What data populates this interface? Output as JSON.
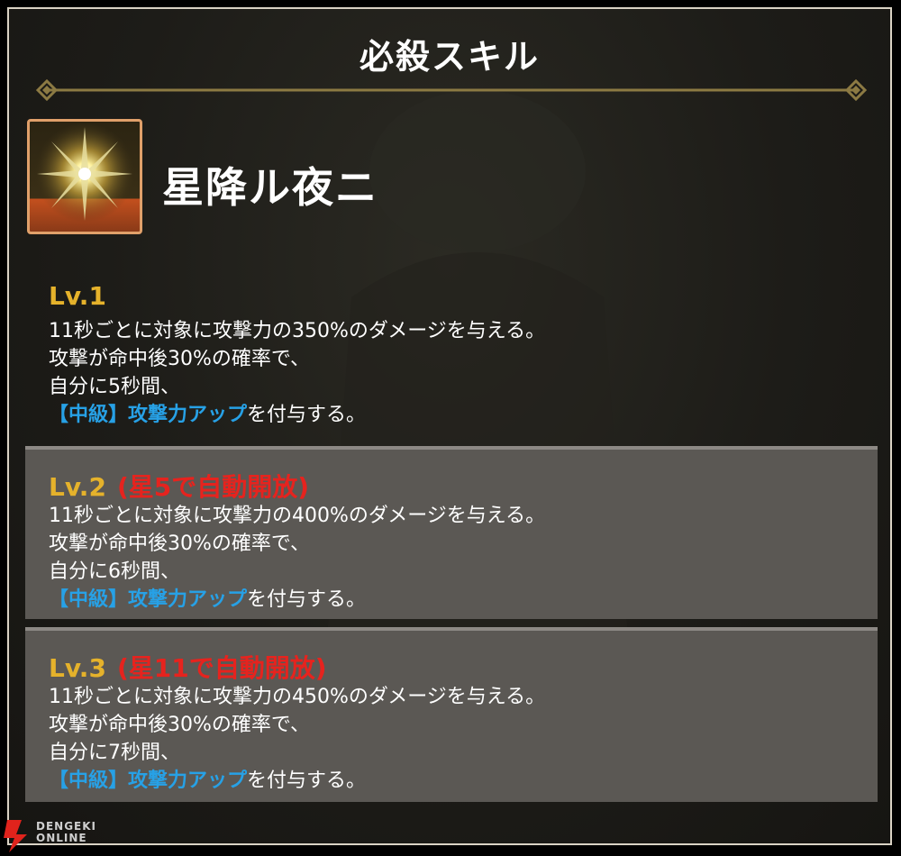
{
  "title": "必殺スキル",
  "skill": {
    "name": "星降ル夜ニ",
    "icon": "star-burst-icon"
  },
  "levels": [
    {
      "label": "Lv.1",
      "note": "",
      "lines": [
        "11秒ごとに対象に攻撃力の350%のダメージを与える。",
        "攻撃が命中後30%の確率で、",
        "自分に5秒間、"
      ],
      "buff_highlight": "【中級】攻撃力アップ",
      "buff_suffix": "を付与する。"
    },
    {
      "label": "Lv.2",
      "note": "(星5で自動開放)",
      "lines": [
        "11秒ごとに対象に攻撃力の400%のダメージを与える。",
        "攻撃が命中後30%の確率で、",
        "自分に6秒間、"
      ],
      "buff_highlight": "【中級】攻撃力アップ",
      "buff_suffix": "を付与する。"
    },
    {
      "label": "Lv.3",
      "note": "(星11で自動開放)",
      "lines": [
        "11秒ごとに対象に攻撃力の450%のダメージを与える。",
        "攻撃が命中後30%の確率で、",
        "自分に7秒間、"
      ],
      "buff_highlight": "【中級】攻撃力アップ",
      "buff_suffix": "を付与する。"
    }
  ],
  "watermark": {
    "line1": "DENGEKI",
    "line2": "ONLINE",
    "icon": "lightning-bolt-icon"
  },
  "colors": {
    "level_label": "#e5b22b",
    "unlock_note": "#e6231e",
    "buff_highlight": "#27a1e6",
    "level_panel": "#5b5854",
    "icon_border": "#e0a06a"
  }
}
